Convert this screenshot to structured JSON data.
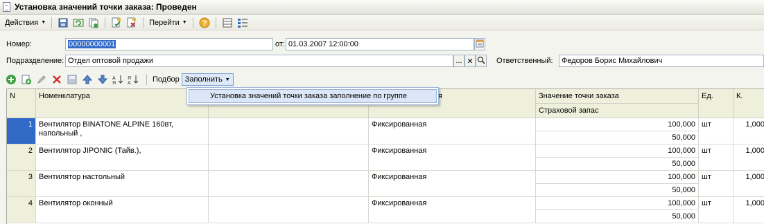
{
  "window": {
    "title": "Установка значений точки заказа: Проведен"
  },
  "toolbar": {
    "actions_label": "Действия",
    "goto_label": "Перейти",
    "icons": [
      "save-post-icon",
      "refresh-icon",
      "copy-icon",
      "post-icon",
      "unpost-icon",
      "help-icon",
      "structure-icon",
      "list-settings-icon"
    ]
  },
  "form": {
    "number_label": "Номер:",
    "number_value": "00000000001",
    "date_label": "от:",
    "date_value": "01.03.2007 12:00:00",
    "division_label": "Подразделение:",
    "division_value": "Отдел оптовой продажи",
    "responsible_label": "Ответственный:",
    "responsible_value": "Федоров Борис Михайлович",
    "select_btn": "...",
    "clear_btn": "✕",
    "open_btn": "Q"
  },
  "table_toolbar": {
    "pick_label": "Подбор",
    "fill_label": "Заполнить",
    "fill_menu": [
      "Установка значений точки заказа заполнение по группе"
    ]
  },
  "grid": {
    "headers": {
      "n": "N",
      "nomenclature": "Номенклатура",
      "type_partial": "я",
      "value": "Значение точки заказа",
      "safety": "Страховой запас",
      "unit": "Ед.",
      "coef": "К."
    },
    "rows": [
      {
        "n": "1",
        "name": "Вентилятор BINATONE ALPINE 160вт, напольный ,",
        "type": "Фиксированная",
        "value": "100,000",
        "safety": "50,000",
        "unit": "шт",
        "coef": "1,000"
      },
      {
        "n": "2",
        "name": "Вентилятор JIPONIC (Тайв.),",
        "type": "Фиксированная",
        "value": "100,000",
        "safety": "50,000",
        "unit": "шт",
        "coef": "1,000"
      },
      {
        "n": "3",
        "name": "Вентилятор настольный",
        "type": "Фиксированная",
        "value": "100,000",
        "safety": "50,000",
        "unit": "шт",
        "coef": "1,000"
      },
      {
        "n": "4",
        "name": "Вентилятор оконный",
        "type": "Фиксированная",
        "value": "100,000",
        "safety": "50,000",
        "unit": "шт",
        "coef": "1,000"
      }
    ]
  }
}
